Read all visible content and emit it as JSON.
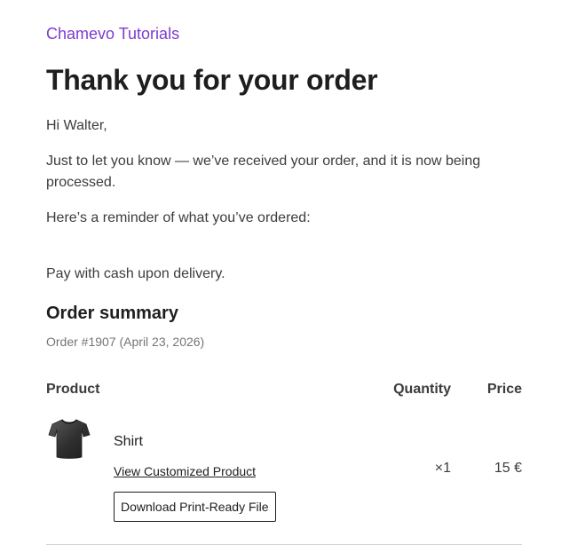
{
  "header": {
    "brand": "Chamevo Tutorials"
  },
  "main": {
    "title": "Thank you for your order",
    "greeting": "Hi Walter,",
    "intro": "Just to let you know — we’ve received your order, and it is now being processed.",
    "reminder": "Here’s a reminder of what you’ve ordered:",
    "payment_note": "Pay with cash upon delivery."
  },
  "summary": {
    "title": "Order summary",
    "order_meta": "Order #1907 (April 23, 2026)",
    "columns": {
      "product": "Product",
      "quantity": "Quantity",
      "price": "Price"
    },
    "items": [
      {
        "name": "Shirt",
        "icon": "tshirt-icon",
        "link_label": "View Customized Product",
        "button_label": "Download Print-Ready File",
        "quantity": "×1",
        "price": "15 €"
      }
    ]
  },
  "colors": {
    "brand": "#7e3bd0",
    "text": "#3c3c3c",
    "heading": "#1e1e1e",
    "muted": "#757575",
    "divider": "#d4d4d4"
  }
}
